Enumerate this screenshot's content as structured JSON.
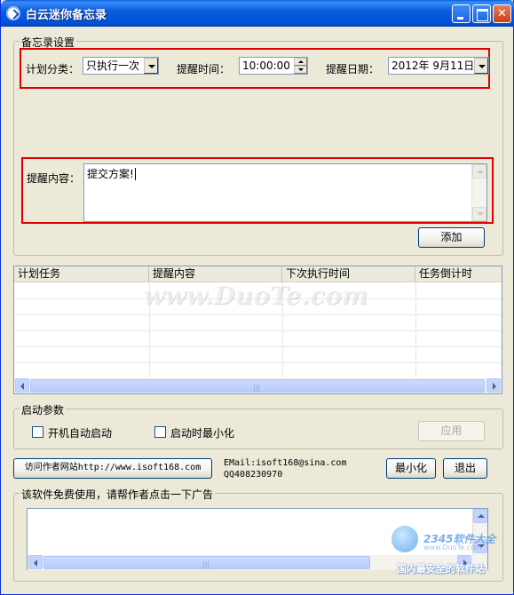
{
  "window": {
    "title": "白云迷你备忘录"
  },
  "settings": {
    "legend": "备忘录设置",
    "category_label": "计划分类：",
    "category_value": "只执行一次",
    "time_label": "提醒时间：",
    "time_value": "10:00:00",
    "date_label": "提醒日期：",
    "date_value": "2012年 9月11日",
    "content_label": "提醒内容：",
    "content_value": "提交方案!",
    "add_button": "添加"
  },
  "task_list": {
    "columns": [
      "计划任务",
      "提醒内容",
      "下次执行时间",
      "任务倒计时"
    ],
    "rows": []
  },
  "startup": {
    "legend": "启动参数",
    "autostart_label": "开机自动启动",
    "autostart_checked": false,
    "minimize_label": "启动时最小化",
    "minimize_checked": false,
    "apply_button": "应用"
  },
  "footer": {
    "visit_button": "访问作者网站http://www.isoft168.com",
    "email": "EMail:isoft168@sina.com",
    "qq": "QQ408230970",
    "minimize_button": "最小化",
    "exit_button": "退出"
  },
  "ad": {
    "legend": "该软件免费使用，请帮作者点击一下广告"
  },
  "watermarks": {
    "center": "www.DuoTe.com",
    "corner_brand": "2345软件大全",
    "corner_url": "www.DuoTe.com",
    "corner_slogan": "国内最安全的软件站"
  },
  "colors": {
    "titlebar": "#0a5ddf",
    "highlight": "#e00000",
    "window_bg": "#ece9d8"
  }
}
